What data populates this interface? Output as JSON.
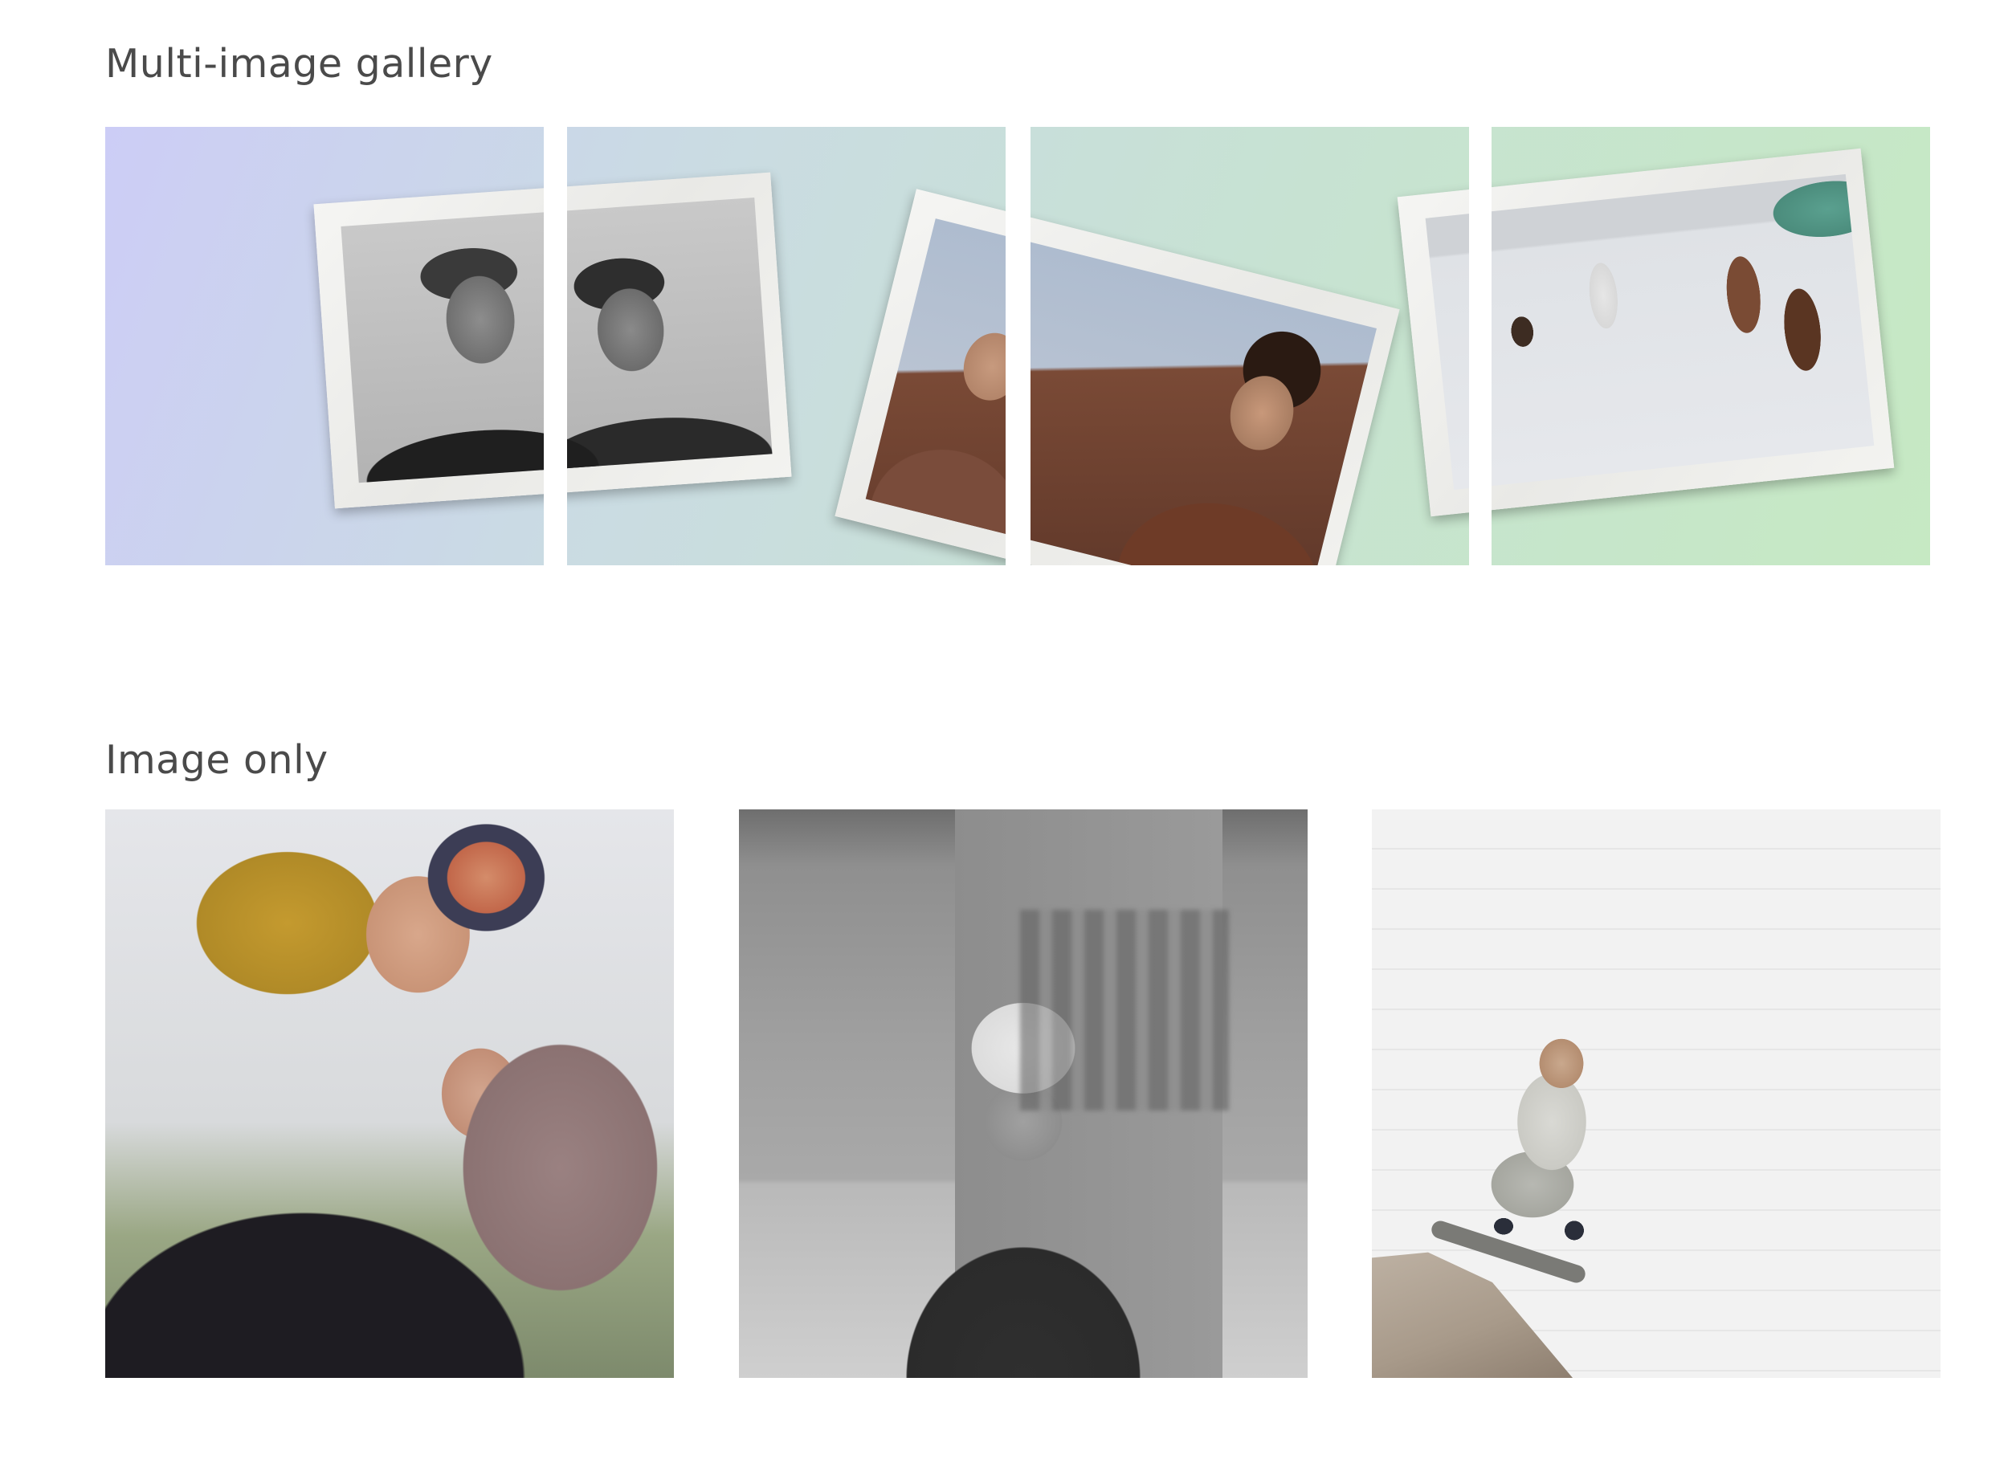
{
  "sections": {
    "gallery": {
      "title": "Multi-image gallery",
      "panel_count": 4
    },
    "image_only": {
      "title": "Image only",
      "tiles": [
        {
          "subject": "mother-lifting-baby"
        },
        {
          "subject": "child-in-beanie"
        },
        {
          "subject": "child-skateboarding"
        }
      ]
    }
  },
  "colors": {
    "text": "#4a4a4a",
    "gallery_gradient_start": "#cccdf6",
    "gallery_gradient_end": "#c6e9c3",
    "background": "#ffffff"
  }
}
